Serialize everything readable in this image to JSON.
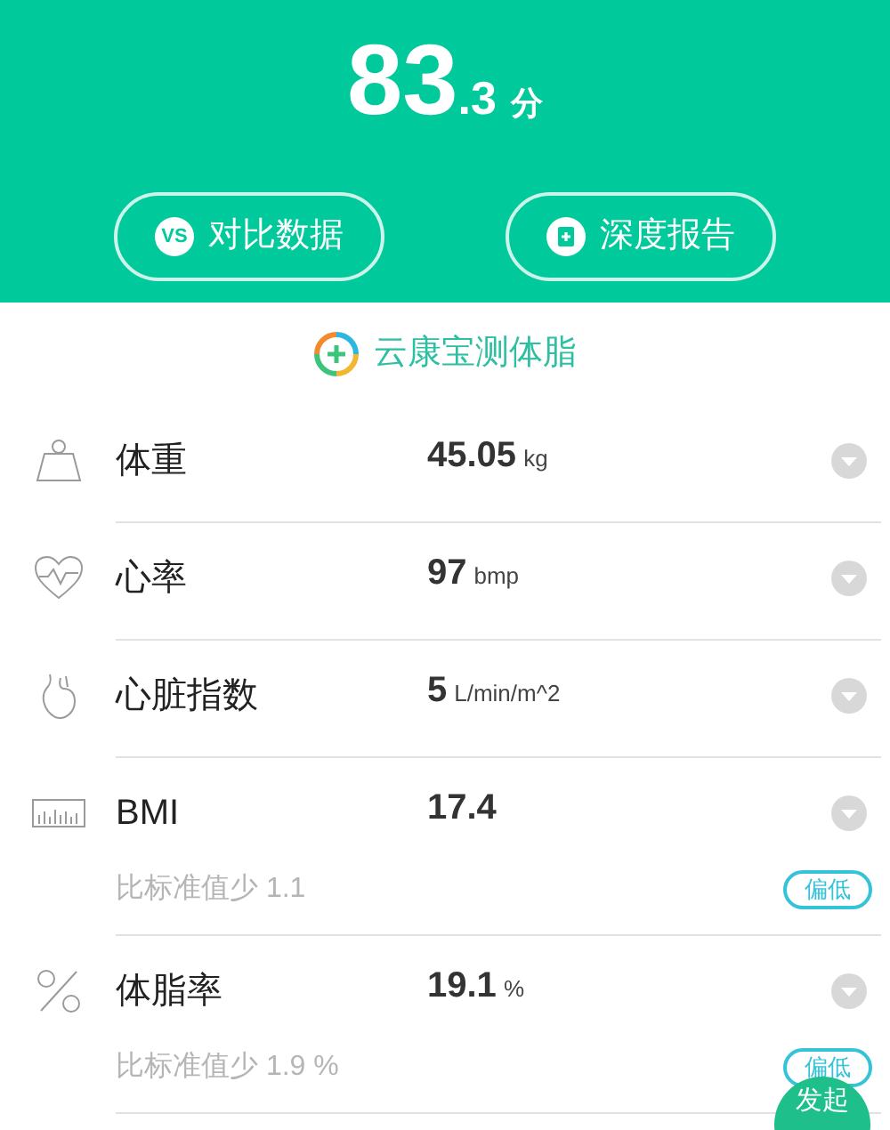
{
  "score": {
    "integer": "83",
    "decimal": ".3",
    "unit": "分"
  },
  "buttons": [
    {
      "kind": "vs",
      "label": "对比数据",
      "icon_text": "VS"
    },
    {
      "kind": "report",
      "label": "深度报告"
    }
  ],
  "brand": {
    "name": "云康宝测体脂"
  },
  "metrics": [
    {
      "kind": "weight",
      "label": "体重",
      "value": "45.05",
      "unit": "kg"
    },
    {
      "kind": "heart_rate",
      "label": "心率",
      "value": "97",
      "unit": "bmp"
    },
    {
      "kind": "heart",
      "label": "心脏指数",
      "value": "5",
      "unit": "L/min/m^2"
    },
    {
      "kind": "bmi",
      "label": "BMI",
      "value": "17.4",
      "note": "比标准值少 1.1",
      "badge": "偏低"
    },
    {
      "kind": "percent",
      "label": "体脂率",
      "value": "19.1",
      "unit": "%",
      "note": "比标准值少 1.9 %",
      "badge": "偏低"
    }
  ],
  "fab": {
    "label": "发起"
  }
}
